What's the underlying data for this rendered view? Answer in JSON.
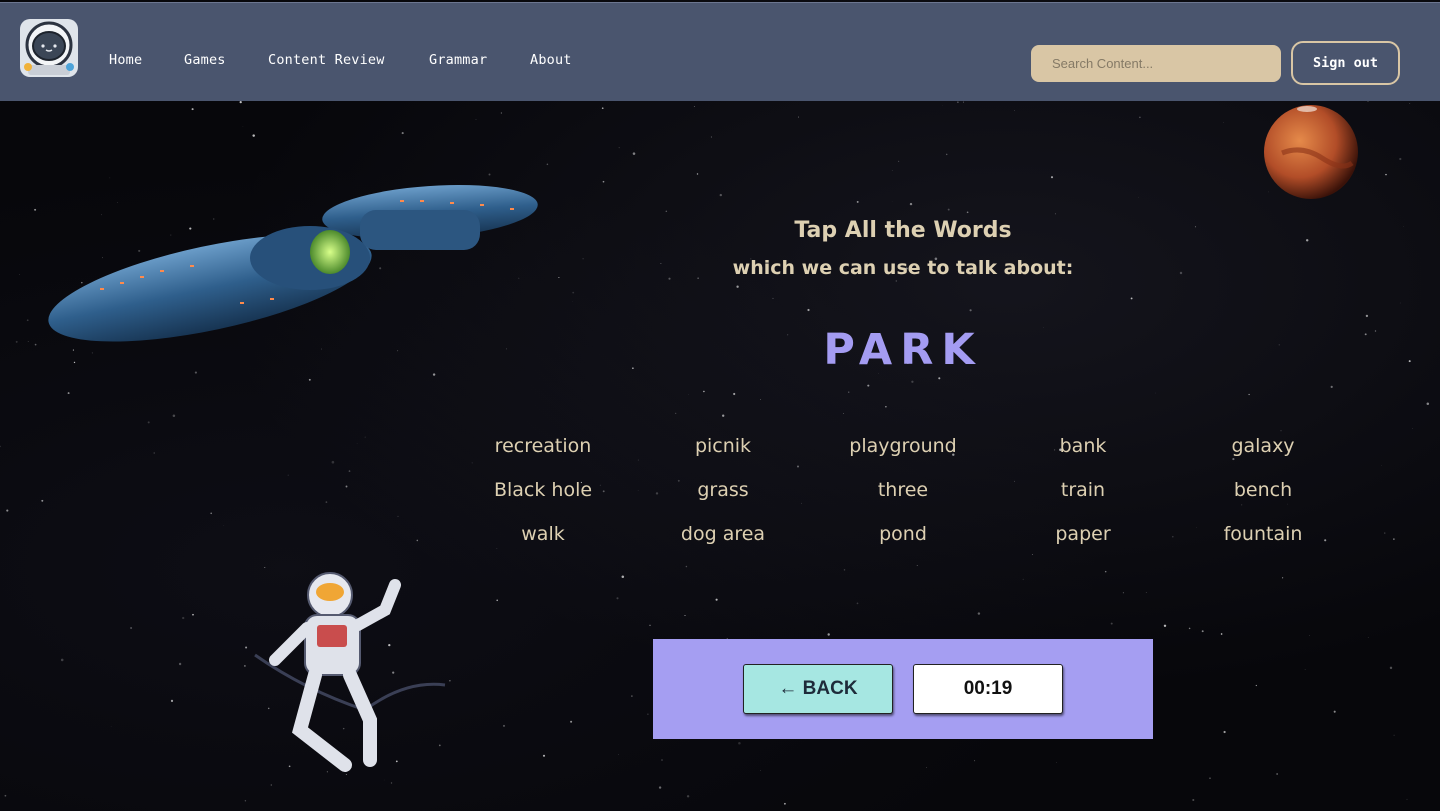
{
  "nav": {
    "links": [
      {
        "label": "Home"
      },
      {
        "label": "Games"
      },
      {
        "label": "Content Review"
      },
      {
        "label": "Grammar"
      },
      {
        "label": "About"
      }
    ],
    "search_placeholder": "Search Content...",
    "signout_label": "Sign out"
  },
  "game": {
    "instruction_line1": "Tap All the Words",
    "instruction_line2": "which we can use to talk about:",
    "topic": "PARK",
    "words": [
      "recreation",
      "picnik",
      "playground",
      "bank",
      "galaxy",
      "Black hole",
      "grass",
      "three",
      "train",
      "bench",
      "walk",
      "dog area",
      "pond",
      "paper",
      "fountain"
    ],
    "back_label": "← BACK",
    "timer": "00:19"
  },
  "colors": {
    "header_bg": "#4a556e",
    "search_bg": "#d9c6a5",
    "topic_color": "#a49cf2",
    "panel_bg": "#a59ef2",
    "back_bg": "#a6e7e2",
    "word_color": "#ddd0b2"
  }
}
